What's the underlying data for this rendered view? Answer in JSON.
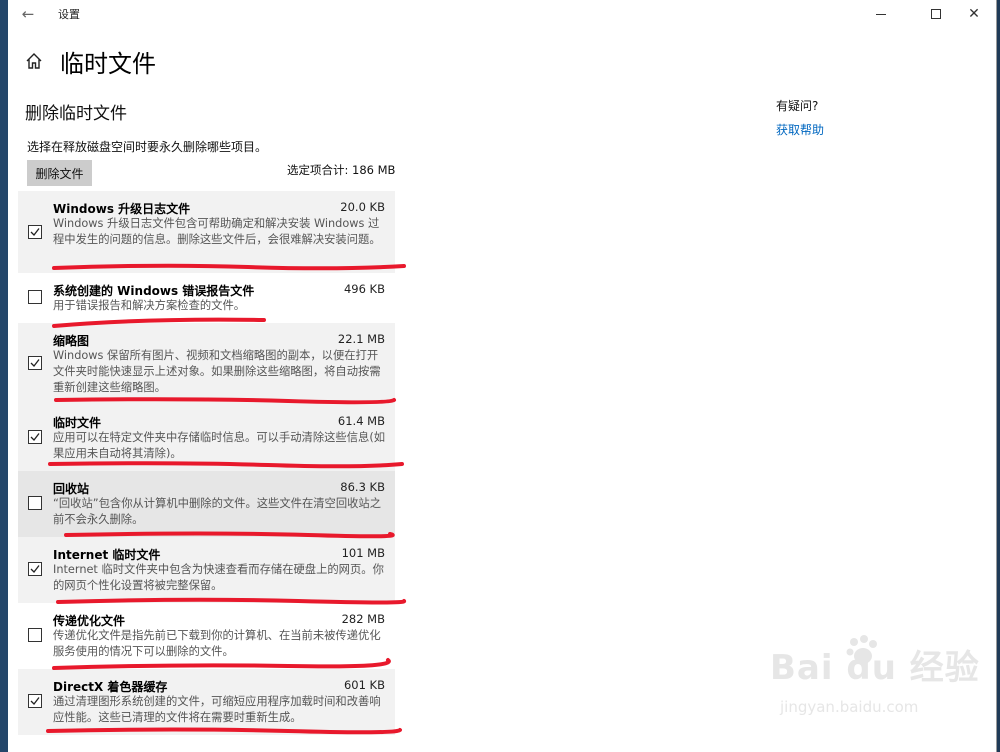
{
  "window": {
    "title": "设置"
  },
  "page": {
    "title": "临时文件",
    "section_title": "删除临时文件",
    "description": "选择在释放磁盘空间时要永久删除哪些项目。",
    "delete_button": "删除文件",
    "total": "选定项合计: 186 MB"
  },
  "sidebar": {
    "question": "有疑问?",
    "help_link": "获取帮助"
  },
  "items": [
    {
      "title": "Windows 升级日志文件",
      "size": "20.0 KB",
      "checked": true,
      "description": "Windows 升级日志文件包含可帮助确定和解决安装 Windows 过程中发生的问题的信息。删除这些文件后，会很难解决安装问题。"
    },
    {
      "title": "系统创建的 Windows 错误报告文件",
      "size": "496 KB",
      "checked": false,
      "description": "用于错误报告和解决方案检查的文件。"
    },
    {
      "title": "缩略图",
      "size": "22.1 MB",
      "checked": true,
      "description": "Windows 保留所有图片、视频和文档缩略图的副本，以便在打开文件夹时能快速显示上述对象。如果删除这些缩略图，将自动按需重新创建这些缩略图。"
    },
    {
      "title": "临时文件",
      "size": "61.4 MB",
      "checked": true,
      "description": "应用可以在特定文件夹中存储临时信息。可以手动清除这些信息(如果应用未自动将其清除)。"
    },
    {
      "title": "回收站",
      "size": "86.3 KB",
      "checked": false,
      "description": "“回收站”包含你从计算机中删除的文件。这些文件在清空回收站之前不会永久删除。"
    },
    {
      "title": "Internet 临时文件",
      "size": "101 MB",
      "checked": true,
      "description": "Internet 临时文件夹中包含为快速查看而存储在硬盘上的网页。你的网页个性化设置将被完整保留。"
    },
    {
      "title": "传递优化文件",
      "size": "282 MB",
      "checked": false,
      "description": "传递优化文件是指先前已下载到你的计算机、在当前未被传递优化服务使用的情况下可以删除的文件。"
    },
    {
      "title": "DirectX 着色器缓存",
      "size": "601 KB",
      "checked": true,
      "description": "通过清理图形系统创建的文件，可缩短应用程序加载时间和改善响应性能。这些已清理的文件将在需要时重新生成。"
    }
  ],
  "watermark": {
    "brand": "Bai du 经验",
    "url": "jingyan.baidu.com"
  },
  "colors": {
    "link": "#0067c0",
    "annotation": "#e8192c",
    "row_bg": "#f2f2f2"
  }
}
